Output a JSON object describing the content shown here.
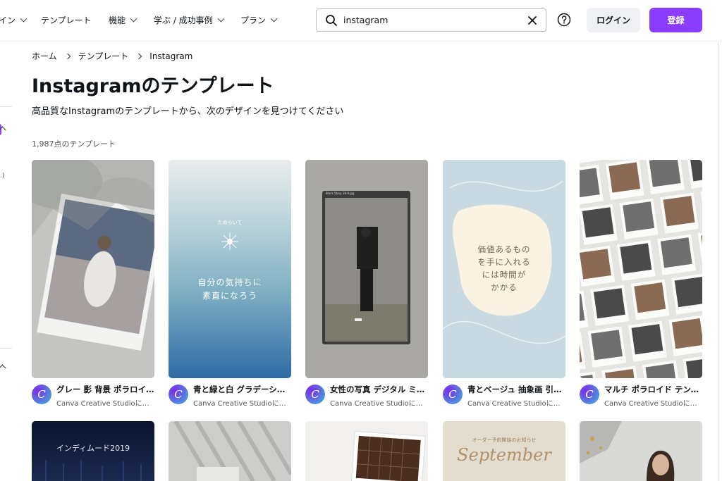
{
  "nav": {
    "items": [
      {
        "label": "イン",
        "chevron": true
      },
      {
        "label": "テンプレート",
        "chevron": false
      },
      {
        "label": "機能",
        "chevron": true
      },
      {
        "label": "学ぶ / 成功事例",
        "chevron": true
      },
      {
        "label": "プラン",
        "chevron": true
      }
    ],
    "search_value": "instagram",
    "login_label": "ログイン",
    "signup_label": "登録"
  },
  "breadcrumb": [
    "ホーム",
    "テンプレート",
    "Instagram"
  ],
  "page_title": "Instagramのテンプレート",
  "subtitle": "高品質なInstagramのテンプレートから、次のデザインを見つけてください",
  "count": "1,987点のテンプレート",
  "left_fragment": ".)",
  "cards": [
    {
      "title": "グレー 影 背景 ポラロイド 写真 インスタグラムストーリー",
      "author": "Canva Creative Studioによる作品",
      "avatar": "C"
    },
    {
      "title": "青と緑と白 グラデーション シンプル インスタグラムストーリー",
      "author": "Canva Creative Studioによる作品",
      "avatar": "C",
      "thumb_small": "ためらいて",
      "thumb_text": [
        "自分の気持ちに",
        "素直になろう"
      ]
    },
    {
      "title": "女性の写真 デジタル ミニマル インスタグラムストーリー",
      "author": "Canva Creative Studioによる作品",
      "avatar": "C",
      "thumb_small": "Black Story 16-9.jpg"
    },
    {
      "title": "青とベージュ 抽象画 引用 インスタグラムストーリー",
      "author": "Canva Creative Studioによる作品",
      "avatar": "C",
      "thumb_text": [
        "価値あるもの",
        "を手に入れる",
        "には時間が",
        "かかる"
      ]
    },
    {
      "title": "マルチ ポラロイド テンプレート インスタグラムストーリー",
      "author": "Canva Creative Studioによる作品",
      "avatar": "C"
    }
  ],
  "row2": [
    {
      "text": "インディムード2019"
    },
    {
      "text": ""
    },
    {
      "text": ""
    },
    {
      "small": "オーダー予約開始のお知らせ",
      "script": "September"
    },
    {
      "text": ""
    }
  ],
  "colors": {
    "accent": "#8b3dff",
    "text": "#0e1318"
  }
}
